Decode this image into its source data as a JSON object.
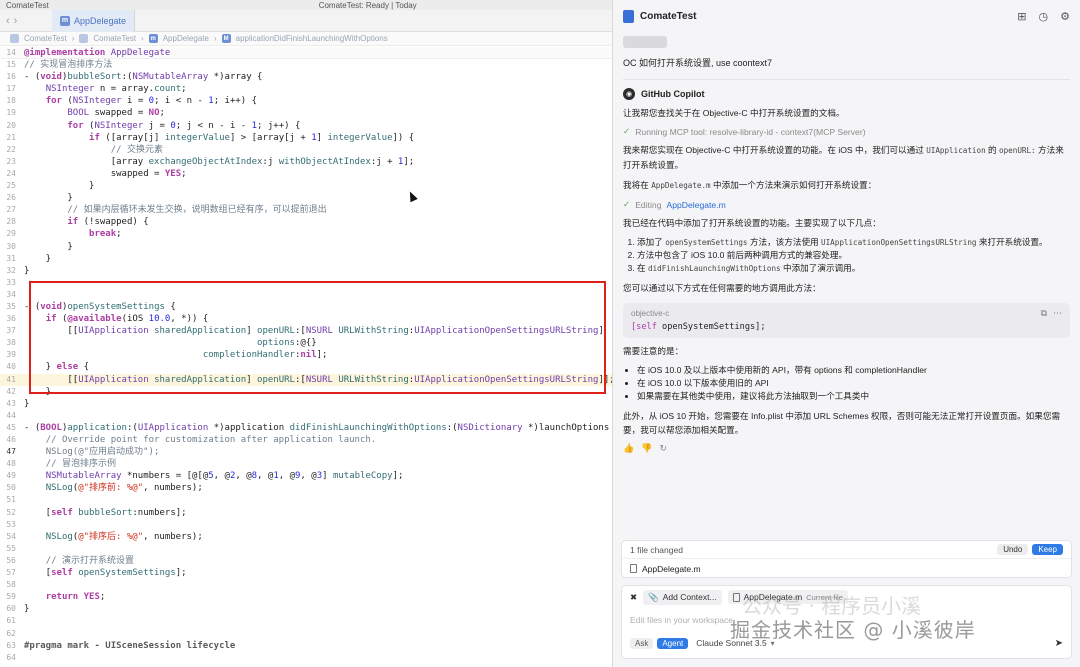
{
  "window": {
    "title": "ComateTest",
    "subtitle": "ComateTest: Ready | Today"
  },
  "tab": {
    "label": "AppDelegate",
    "icon": "m"
  },
  "jumpbar": [
    "ComateTest",
    "ComateTest",
    "AppDelegate",
    "applicationDidFinishLaunchingWithOptions"
  ],
  "code_lines": [
    {
      "n": "14",
      "h": "<span class='kw'>@implementation</span> <span class='ty'>AppDelegate</span>",
      "cls": "top"
    },
    {
      "n": "15",
      "h": "<span class='cm'>// 实现冒泡排序方法</span>"
    },
    {
      "n": "16",
      "h": "- (<span class='kw'>void</span>)<span class='fn'>bubbleSort</span>:(<span class='ty'>NSMutableArray</span> *)array {"
    },
    {
      "n": "17",
      "h": "    <span class='ty'>NSInteger</span> n = array.<span class='fn'>count</span>;"
    },
    {
      "n": "18",
      "h": "    <span class='kw'>for</span> (<span class='ty'>NSInteger</span> i = <span class='nm'>0</span>; i &lt; n - <span class='nm'>1</span>; i++) {"
    },
    {
      "n": "19",
      "h": "        <span class='ty'>BOOL</span> swapped = <span class='kw'>NO</span>;"
    },
    {
      "n": "20",
      "h": "        <span class='kw'>for</span> (<span class='ty'>NSInteger</span> j = <span class='nm'>0</span>; j &lt; n - i - <span class='nm'>1</span>; j++) {"
    },
    {
      "n": "21",
      "h": "            <span class='kw'>if</span> ([array[j] <span class='fn'>integerValue</span>] &gt; [array[j + <span class='nm'>1</span>] <span class='fn'>integerValue</span>]) {"
    },
    {
      "n": "22",
      "h": "                <span class='cm'>// 交换元素</span>"
    },
    {
      "n": "23",
      "h": "                [array <span class='fn'>exchangeObjectAtIndex</span>:j <span class='fn'>withObjectAtIndex</span>:j + <span class='nm'>1</span>];"
    },
    {
      "n": "24",
      "h": "                swapped = <span class='kw'>YES</span>;"
    },
    {
      "n": "25",
      "h": "            }"
    },
    {
      "n": "26",
      "h": "        }"
    },
    {
      "n": "27",
      "h": "        <span class='cm'>// 如果内层循环未发生交换，说明数组已经有序，可以提前退出</span>"
    },
    {
      "n": "28",
      "h": "        <span class='kw'>if</span> (!swapped) {"
    },
    {
      "n": "29",
      "h": "            <span class='kw'>break</span>;"
    },
    {
      "n": "30",
      "h": "        }"
    },
    {
      "n": "31",
      "h": "    }"
    },
    {
      "n": "32",
      "h": "}"
    },
    {
      "n": "33",
      "h": ""
    },
    {
      "n": "34",
      "h": ""
    },
    {
      "n": "35",
      "h": "- (<span class='kw'>void</span>)<span class='fn'>openSystemSettings</span> {"
    },
    {
      "n": "36",
      "h": "    <span class='kw'>if</span> (<span class='kw'>@available</span>(iOS <span class='nm'>10.0</span>, *)) {"
    },
    {
      "n": "37",
      "h": "        [[<span class='ty'>UIApplication</span> <span class='fn'>sharedApplication</span>] <span class='fn'>openURL</span>:[<span class='ty'>NSURL</span> <span class='fn'>URLWithString</span>:<span class='ty'>UIApplicationOpenSettingsURLString</span>]"
    },
    {
      "n": "38",
      "h": "                                           <span class='fn'>options</span>:@{}"
    },
    {
      "n": "39",
      "h": "                                 <span class='fn'>completionHandler</span>:<span class='kw'>nil</span>];"
    },
    {
      "n": "40",
      "h": "    } <span class='kw'>else</span> {"
    },
    {
      "n": "41",
      "h": "        [[<span class='ty'>UIApplication</span> <span class='fn'>sharedApplication</span>] <span class='fn'>openURL</span>:[<span class='ty'>NSURL</span> <span class='fn'>URLWithString</span>:<span class='ty'>UIApplicationOpenSettingsURLString</span>]];",
      "cls": "hl"
    },
    {
      "n": "42",
      "h": "    }"
    },
    {
      "n": "43",
      "h": "}"
    },
    {
      "n": "44",
      "h": ""
    },
    {
      "n": "45",
      "h": "- (<span class='kw'>BOOL</span>)<span class='fn'>application</span>:(<span class='ty'>UIApplication</span> *)application <span class='fn'>didFinishLaunchingWithOptions</span>:(<span class='ty'>NSDictionary</span> *)launchOptions {"
    },
    {
      "n": "46",
      "h": "    <span class='cm'>// Override point for customization after application launch.</span>"
    },
    {
      "n": "47",
      "h": "    <span class='cm'>NSLog(@\"应用启动成功\");</span>",
      "cur": true
    },
    {
      "n": "48",
      "h": "    <span class='cm'>// 冒泡排序示例</span>"
    },
    {
      "n": "49",
      "h": "    <span class='ty'>NSMutableArray</span> *numbers = [@[@<span class='nm'>5</span>, @<span class='nm'>2</span>, @<span class='nm'>8</span>, @<span class='nm'>1</span>, @<span class='nm'>9</span>, @<span class='nm'>3</span>] <span class='fn'>mutableCopy</span>];"
    },
    {
      "n": "50",
      "h": "    <span class='fn'>NSLog</span>(<span class='st'>@\"排序前: %@\"</span>, numbers);"
    },
    {
      "n": "51",
      "h": ""
    },
    {
      "n": "52",
      "h": "    [<span class='kw'>self</span> <span class='fn'>bubbleSort</span>:numbers];"
    },
    {
      "n": "53",
      "h": ""
    },
    {
      "n": "54",
      "h": "    <span class='fn'>NSLog</span>(<span class='st'>@\"排序后: %@\"</span>, numbers);"
    },
    {
      "n": "55",
      "h": ""
    },
    {
      "n": "56",
      "h": "    <span class='cm'>// 演示打开系统设置</span>"
    },
    {
      "n": "57",
      "h": "    [<span class='kw'>self</span> <span class='fn'>openSystemSettings</span>];"
    },
    {
      "n": "58",
      "h": ""
    },
    {
      "n": "59",
      "h": "    <span class='kw'>return</span> <span class='kw'>YES</span>;"
    },
    {
      "n": "60",
      "h": "}"
    },
    {
      "n": "61",
      "h": ""
    },
    {
      "n": "62",
      "h": ""
    },
    {
      "n": "63",
      "h": "<span class='mk'>#pragma mark - UISceneSession lifecycle</span>"
    },
    {
      "n": "64",
      "h": ""
    }
  ],
  "chat": {
    "title": "ComateTest",
    "user_message": "OC 如何打开系统设置, use coontext7",
    "assistant_name": "GitHub Copilot",
    "p1": "让我帮您查找关于在 Objective-C 中打开系统设置的文档。",
    "tool1": "Running MCP tool: resolve-library-id - context7(MCP Server)",
    "p2a": "我来帮您实现在 Objective-C 中打开系统设置的功能。在 iOS 中，我们可以通过",
    "p2_code1": "UIApplication",
    "p2b": "的",
    "p2_code2": "openURL:",
    "p2c": "方法来打开系统设置。",
    "p3a": "我将在",
    "p3_code": "AppDelegate.m",
    "p3b": "中添加一个方法来演示如何打开系统设置：",
    "tool2_prefix": "Editing",
    "tool2_link": "AppDelegate.m",
    "p4": "我已经在代码中添加了打开系统设置的功能。主要实现了以下几点：",
    "ol1a": "添加了",
    "ol1_code": "openSystemSettings",
    "ol1b": "方法，该方法使用",
    "ol1_code2": "UIApplicationOpenSettingsURLString",
    "ol1c": "来打开系统设置。",
    "ol2": "方法中包含了 iOS 10.0 前后两种调用方式的兼容处理。",
    "ol3a": "在",
    "ol3_code": "didFinishLaunchingWithOptions",
    "ol3b": "中添加了演示调用。",
    "p5": "您可以通过以下方式在任何需要的地方调用此方法：",
    "code_lang": "objective-c",
    "code_self": "[self",
    "code_rest": " openSystemSettings];",
    "p6": "需要注意的是：",
    "ul1": "在 iOS 10.0 及以上版本中使用新的 API，带有 options 和 completionHandler",
    "ul2": "在 iOS 10.0 以下版本使用旧的 API",
    "ul3": "如果需要在其他类中使用，建议将此方法抽取到一个工具类中",
    "p7": "此外，从 iOS 10 开始，您需要在 Info.plist 中添加 URL Schemes 权限，否则可能无法正常打开设置页面。如果您需要，我可以帮您添加相关配置。"
  },
  "changes": {
    "summary": "1 file changed",
    "undo": "Undo",
    "keep": "Keep",
    "file": "AppDelegate.m"
  },
  "composer": {
    "add_context": "Add Context...",
    "current_file": "AppDelegate.m",
    "current_file_tag": "Current file",
    "placeholder": "Edit files in your workspace",
    "mode_ask": "Ask",
    "mode_agent": "Agent",
    "model": "Claude Sonnet 3.5"
  },
  "watermark": {
    "main": "掘金技术社区 @ 小溪彼岸",
    "faint": "公众号 · 程序员小溪"
  }
}
